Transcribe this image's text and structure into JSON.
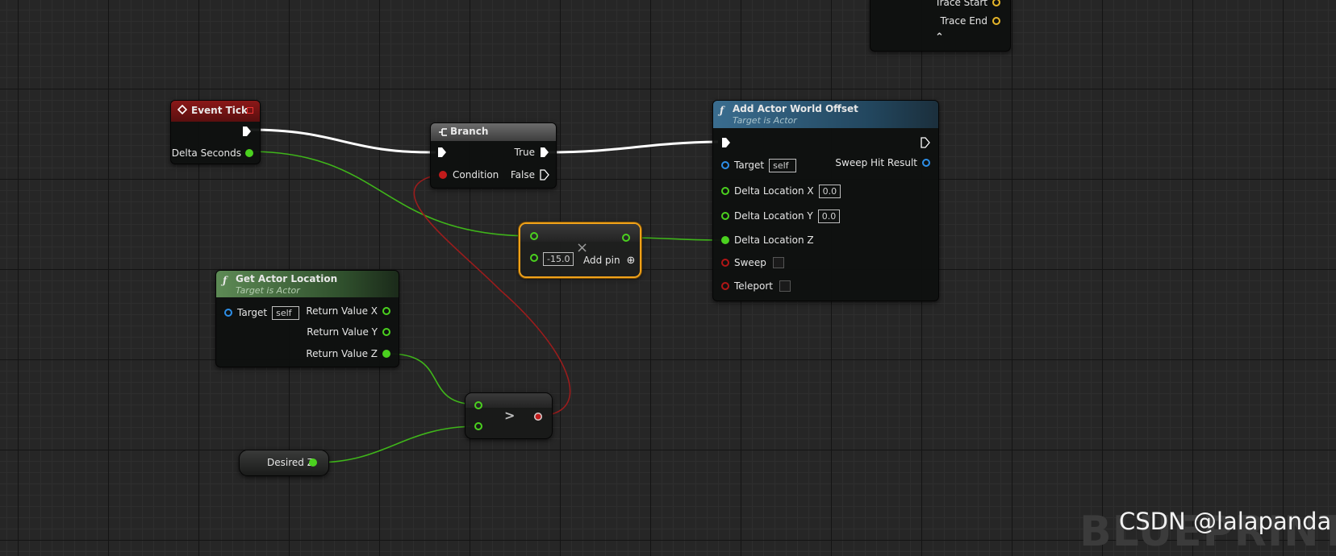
{
  "trace_node": {
    "trace_start_label": "Trace Start",
    "trace_end_label": "Trace End",
    "collapse_glyph": "⌃"
  },
  "event_tick": {
    "title": "Event Tick",
    "delta_seconds_label": "Delta Seconds"
  },
  "branch": {
    "title": "Branch",
    "condition_label": "Condition",
    "true_label": "True",
    "false_label": "False"
  },
  "add_actor_world_offset": {
    "title": "Add Actor World Offset",
    "subtitle": "Target is Actor",
    "target_label": "Target",
    "target_value": "self",
    "sweep_hit_result_label": "Sweep Hit Result",
    "delta_x_label": "Delta Location X",
    "delta_x_value": "0.0",
    "delta_y_label": "Delta Location Y",
    "delta_y_value": "0.0",
    "delta_z_label": "Delta Location Z",
    "sweep_label": "Sweep",
    "teleport_label": "Teleport"
  },
  "multiply": {
    "value": "-15.0",
    "add_pin_label": "Add pin",
    "op_glyph": "×",
    "add_glyph": "⊕"
  },
  "get_actor_location": {
    "title": "Get Actor Location",
    "subtitle": "Target is Actor",
    "target_label": "Target",
    "target_value": "self",
    "rx_label": "Return Value X",
    "ry_label": "Return Value Y",
    "rz_label": "Return Value Z"
  },
  "greater": {
    "op_glyph": ">"
  },
  "desired_z": {
    "label": "Desired Z"
  },
  "watermark": {
    "bg_text": "BLUEPRINT",
    "fg_text": "CSDN @lalapanda"
  },
  "colors": {
    "exec_wire": "#ffffff",
    "float_wire": "#4bd11f",
    "bool_wire": "#9b1c1c",
    "event_header": "#7c1414",
    "function_header": "#2e5b78",
    "pure_header": "#3e6a3a",
    "branch_header": "#5a5a5a",
    "selection": "#f0a21a"
  },
  "icons": {
    "event": "event-diamond-icon",
    "branch": "branch-icon",
    "function": "function-f-icon"
  }
}
